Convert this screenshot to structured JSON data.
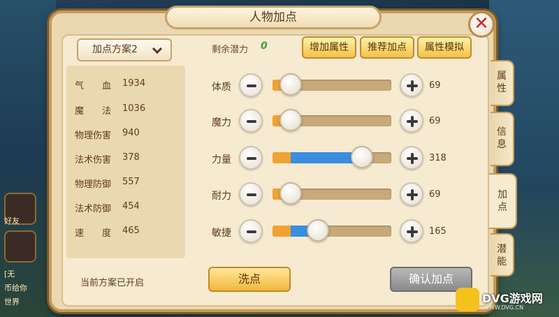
{
  "window": {
    "title": "人物加点"
  },
  "scheme_selector": {
    "label": "加点方案2"
  },
  "stats": [
    {
      "label": "气　　血",
      "value": "1934"
    },
    {
      "label": "魔　　法",
      "value": "1036"
    },
    {
      "label": "物理伤害",
      "value": "940"
    },
    {
      "label": "法术伤害",
      "value": "378"
    },
    {
      "label": "物理防御",
      "value": "557"
    },
    {
      "label": "法术防御",
      "value": "454"
    },
    {
      "label": "速　　度",
      "value": "465"
    }
  ],
  "scheme_status": "当前方案已开启",
  "potential": {
    "label": "剩余潜力",
    "value": "0"
  },
  "top_buttons": {
    "add_attr": "增加属性",
    "recommend": "推荐加点",
    "simulate": "属性模拟"
  },
  "attributes": [
    {
      "label": "体质",
      "value": "69",
      "base_fraction": 0.07,
      "added_fraction": 0.0
    },
    {
      "label": "魔力",
      "value": "69",
      "base_fraction": 0.07,
      "added_fraction": 0.0
    },
    {
      "label": "力量",
      "value": "318",
      "base_fraction": 0.15,
      "added_fraction": 0.6
    },
    {
      "label": "耐力",
      "value": "69",
      "base_fraction": 0.07,
      "added_fraction": 0.0
    },
    {
      "label": "敏捷",
      "value": "165",
      "base_fraction": 0.15,
      "added_fraction": 0.23
    }
  ],
  "bottom_buttons": {
    "reset": "洗点",
    "confirm": "确认加点"
  },
  "side_tabs": [
    {
      "label_top": "属",
      "label_bottom": "性"
    },
    {
      "label_top": "信",
      "label_bottom": "息"
    },
    {
      "label_top": "加",
      "label_bottom": "点"
    },
    {
      "label_top": "潜",
      "label_bottom": "能"
    }
  ],
  "active_tab": "加点",
  "hud": {
    "friends_label": "好友",
    "chat_label_1": "[无",
    "chat_label_2": "币给你",
    "chat_label_3": "世界"
  },
  "watermark": {
    "text": "DVG游戏网",
    "url": "WWW.DVG.CN"
  },
  "colors": {
    "base_fill": "#f0a233",
    "added_fill": "#3a8ee0",
    "potential": "#3aa13a",
    "close": "#d22a1f"
  },
  "icons": {
    "close": "close-icon",
    "dropdown": "chevron-down-icon",
    "minus": "minus-icon",
    "plus": "plus-icon"
  }
}
